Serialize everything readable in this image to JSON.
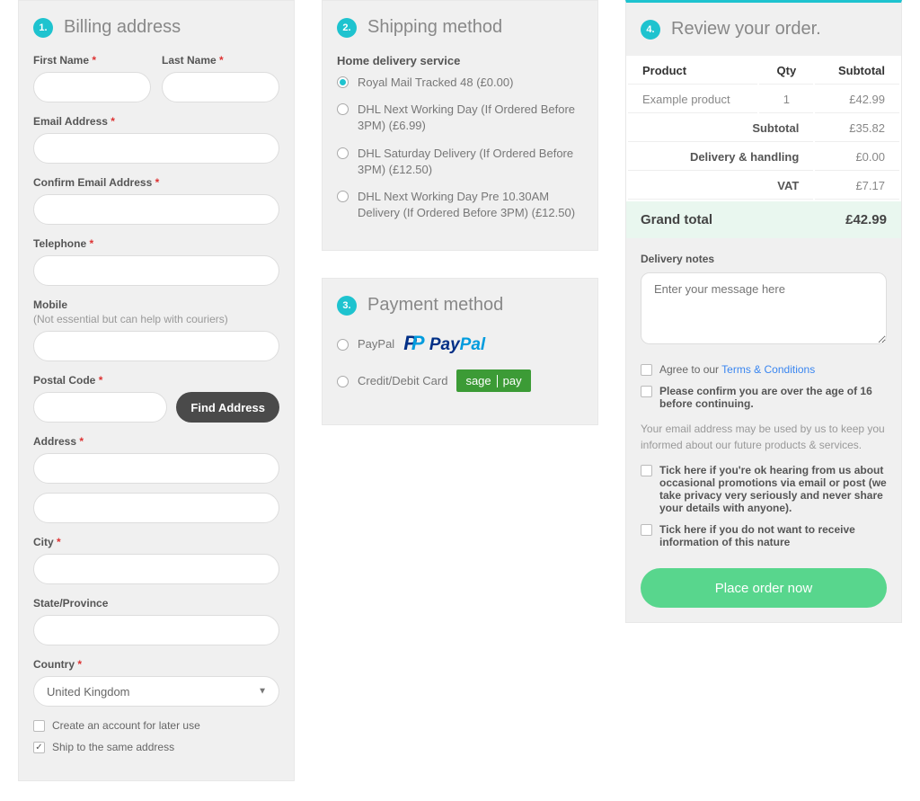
{
  "billing": {
    "step": "1.",
    "title": "Billing address",
    "first_name_label": "First Name",
    "last_name_label": "Last Name",
    "email_label": "Email Address",
    "confirm_email_label": "Confirm Email Address",
    "telephone_label": "Telephone",
    "mobile_label": "Mobile",
    "mobile_hint": "(Not essential but can help with couriers)",
    "postal_label": "Postal Code",
    "find_address_label": "Find Address",
    "address_label": "Address",
    "city_label": "City",
    "state_label": "State/Province",
    "country_label": "Country",
    "country_value": "United Kingdom",
    "create_account_label": "Create an account for later use",
    "ship_same_label": "Ship to the same address"
  },
  "shipping": {
    "step": "2.",
    "title": "Shipping method",
    "group_title": "Home delivery service",
    "options": [
      {
        "label": "Royal Mail Tracked 48  (£0.00)"
      },
      {
        "label": "DHL Next Working Day (If Ordered Before 3PM)  (£6.99)"
      },
      {
        "label": "DHL Saturday Delivery (If Ordered Before 3PM)  (£12.50)"
      },
      {
        "label": "DHL Next Working Day Pre 10.30AM Delivery (If Ordered Before 3PM)  (£12.50)"
      }
    ]
  },
  "payment": {
    "step": "3.",
    "title": "Payment method",
    "paypal_label": "PayPal",
    "card_label": "Credit/Debit Card",
    "sage_left": "sage",
    "sage_right": "pay"
  },
  "review": {
    "step": "4.",
    "title": "Review your order.",
    "headers": {
      "product": "Product",
      "qty": "Qty",
      "subtotal": "Subtotal"
    },
    "item": {
      "name": "Example product",
      "qty": "1",
      "sub": "£42.99"
    },
    "subtotal_label": "Subtotal",
    "subtotal_val": "£35.82",
    "delivery_label": "Delivery & handling",
    "delivery_val": "£0.00",
    "vat_label": "VAT",
    "vat_val": "£7.17",
    "grand_label": "Grand total",
    "grand_val": "£42.99",
    "notes_label": "Delivery notes",
    "notes_placeholder": "Enter your message here",
    "agree_text": "Agree to our ",
    "terms_link": "Terms & Conditions",
    "age_text": "Please confirm you are over the age of 16 before continuing.",
    "email_disclaimer": "Your email address may be used by us to keep you informed about our future products & services.",
    "optin_text": "Tick here if you're ok hearing from us about occasional promotions via email or post (we take privacy very seriously and never share your details with anyone).",
    "optout_text": "Tick here if you do not want to receive information of this nature",
    "place_order_label": "Place order now"
  }
}
